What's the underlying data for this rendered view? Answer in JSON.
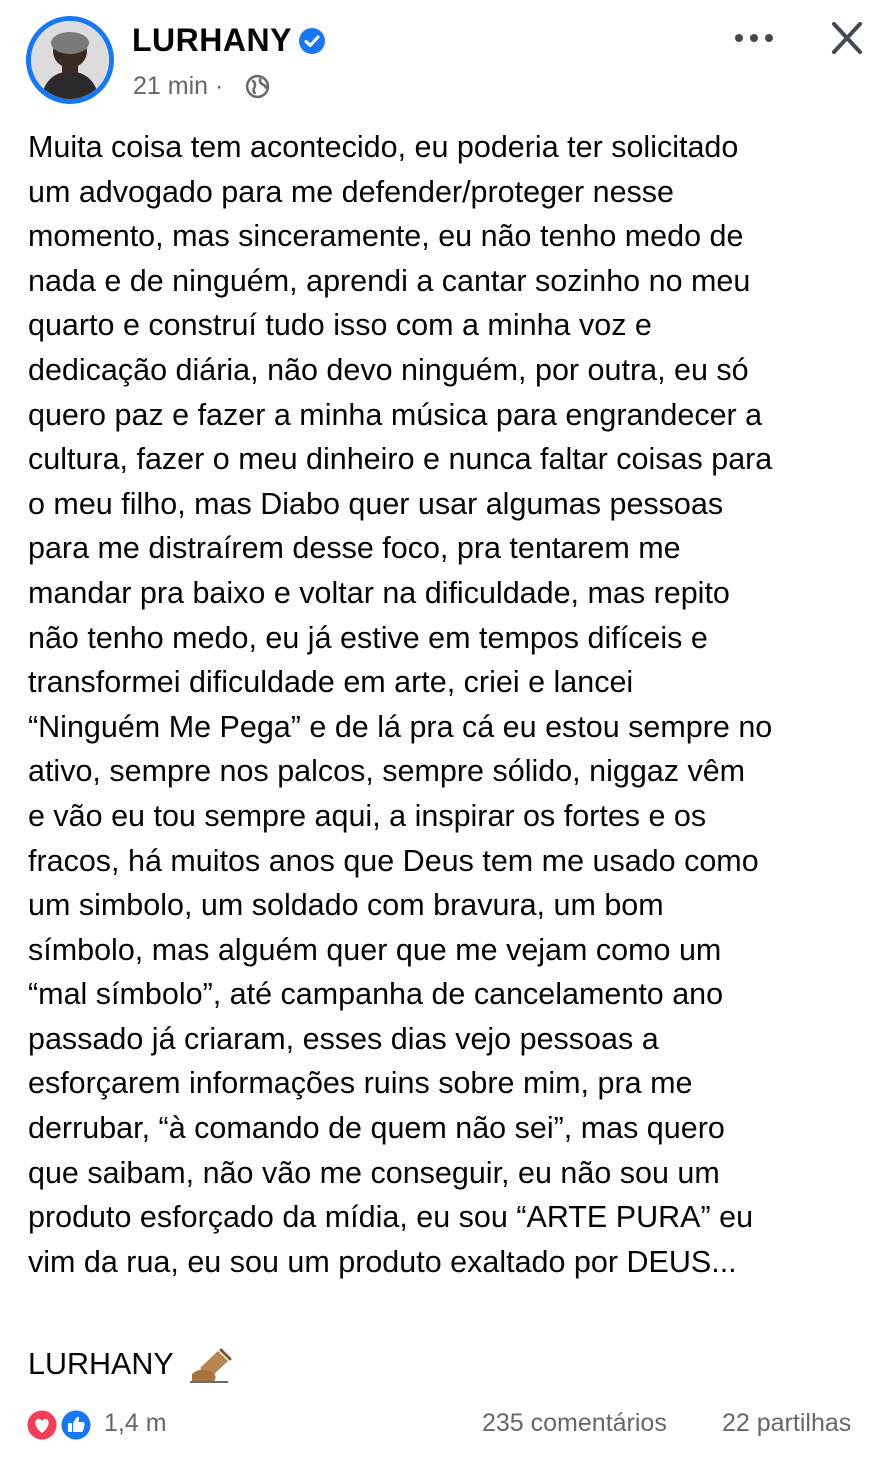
{
  "header": {
    "author": "LURHANY",
    "time": "21 min",
    "separator": "·",
    "verified_icon": "verified-badge-icon",
    "audience_icon": "globe-icon",
    "more_icon": "more-horizontal-icon",
    "close_icon": "close-icon"
  },
  "post": {
    "lines": [
      "Muita coisa tem acontecido, eu poderia ter solicitado",
      "um advogado para me defender/proteger nesse",
      "momento, mas sinceramente, eu não tenho medo de",
      "nada e de ninguém, aprendi a cantar sozinho no meu",
      "quarto e construí tudo isso com a minha voz e",
      "dedicação diária, não devo ninguém, por outra, eu só",
      "quero paz e fazer a minha música para engrandecer a",
      "cultura, fazer o meu dinheiro e nunca faltar coisas para",
      "o meu filho, mas Diabo quer usar algumas pessoas",
      "para me distraírem desse foco, pra tentarem me",
      "mandar pra baixo e voltar na dificuldade, mas repito",
      "não tenho medo, eu já estive em tempos difíceis e",
      "transformei dificuldade em arte, criei e lancei",
      "“Ninguém Me Pega” e de lá pra cá eu estou sempre no",
      "ativo, sempre nos palcos, sempre sólido, niggaz vêm",
      "e vão eu tou sempre aqui, a inspirar os fortes e os",
      "fracos, há muitos anos que Deus tem me usado como",
      "um simbolo, um soldado com bravura, um bom",
      "símbolo, mas alguém quer que me vejam como um",
      "“mal símbolo”, até campanha de cancelamento ano",
      "passado já criaram, esses dias vejo pessoas a",
      "esforçarem informações ruins sobre mim, pra me",
      "derrubar, “à comando de quem não sei”, mas quero",
      "que saibam, não vão me conseguir, eu não sou um",
      "produto esforçado da mídia, eu sou “ARTE PURA” eu",
      "vim da rua, eu sou um produto exaltado por DEUS..."
    ],
    "signature": "LURHANY",
    "signature_icon": "writing-hand-icon"
  },
  "footer": {
    "reaction_icons": [
      "love-reaction-icon",
      "like-reaction-icon"
    ],
    "reactions": "1,4 m",
    "comments": "235 comentários",
    "shares": "22 partilhas"
  },
  "colors": {
    "accent": "#1877f2",
    "love": "#f33e58",
    "meta_text": "#65676b",
    "body_text": "#050505"
  }
}
